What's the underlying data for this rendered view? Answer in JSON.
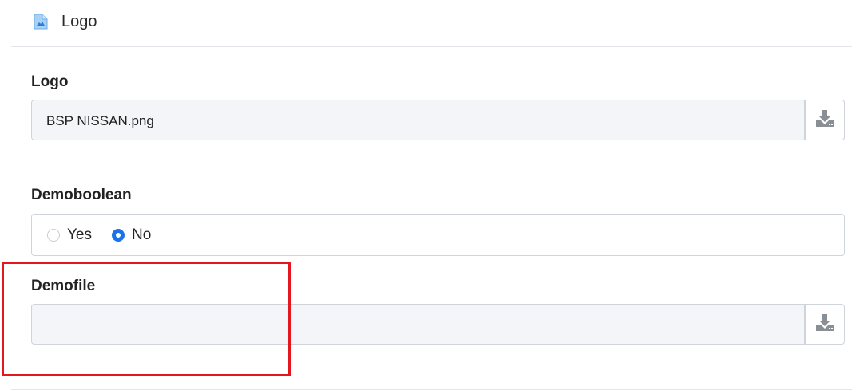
{
  "header": {
    "title": "Logo",
    "icon": "image-file-icon"
  },
  "logo_field": {
    "label": "Logo",
    "value": "BSP NISSAN.png",
    "button_icon": "download-icon"
  },
  "boolean_field": {
    "label": "Demoboolean",
    "options": [
      {
        "label": "Yes",
        "selected": false
      },
      {
        "label": "No",
        "selected": true
      }
    ]
  },
  "file_field": {
    "label": "Demofile",
    "value": "",
    "button_icon": "download-icon"
  },
  "colors": {
    "accent": "#1a73e8",
    "highlight": "#e3171d",
    "input_bg": "#f3f5f8"
  }
}
